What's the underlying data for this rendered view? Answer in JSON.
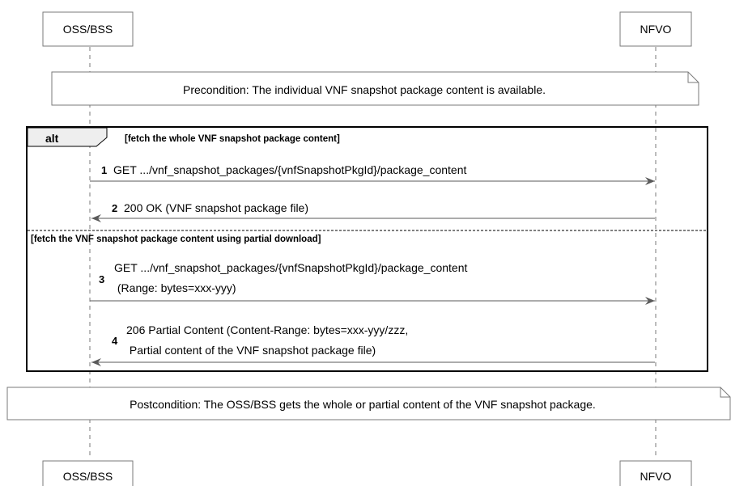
{
  "participants": {
    "left": "OSS/BSS",
    "right": "NFVO"
  },
  "notes": {
    "precondition": "Precondition: The individual VNF snapshot package content is available.",
    "postcondition": "Postcondition: The OSS/BSS gets the whole or partial content of the VNF snapshot package."
  },
  "alt": {
    "keyword": "alt",
    "guard1": "[fetch the whole VNF snapshot package content]",
    "guard2": "[fetch the VNF snapshot package content using partial download]"
  },
  "messages": [
    {
      "number": "1",
      "lines": [
        "GET .../vnf_snapshot_packages/{vnfSnapshotPkgId}/package_content"
      ]
    },
    {
      "number": "2",
      "lines": [
        "200 OK (VNF snapshot package file)"
      ]
    },
    {
      "number": "3",
      "lines": [
        "GET .../vnf_snapshot_packages/{vnfSnapshotPkgId}/package_content",
        " (Range: bytes=xxx-yyy)"
      ]
    },
    {
      "number": "4",
      "lines": [
        "206 Partial Content (Content-Range: bytes=xxx-yyy/zzz,",
        " Partial content of the VNF snapshot package file)"
      ]
    }
  ]
}
